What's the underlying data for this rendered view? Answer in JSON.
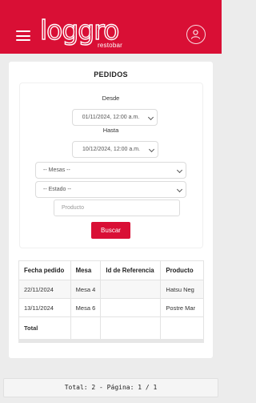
{
  "header": {
    "logo_text": "loggro",
    "logo_sub": "restobar",
    "brand_color": "#d90f35"
  },
  "page": {
    "title": "PEDIDOS"
  },
  "filters": {
    "desde_label": "Desde",
    "desde_value": "01/11/2024, 12:00 a.m.",
    "hasta_label": "Hasta",
    "hasta_value": "10/12/2024, 12:00 a.m.",
    "mesas_value": "-- Mesas --",
    "estado_value": "-- Estado --",
    "producto_placeholder": "Producto",
    "buscar_label": "Buscar"
  },
  "table": {
    "columns": [
      "Fecha pedido",
      "Mesa",
      "Id de Referencia",
      "Producto"
    ],
    "rows": [
      [
        "22/11/2024",
        "Mesa 4",
        "",
        "Hatsu Neg"
      ],
      [
        "13/11/2024",
        "Mesa 6",
        "",
        "Postre Mar"
      ]
    ],
    "total_label": "Total"
  },
  "footer": {
    "text": "Total: 2 - Página: 1 / 1"
  }
}
